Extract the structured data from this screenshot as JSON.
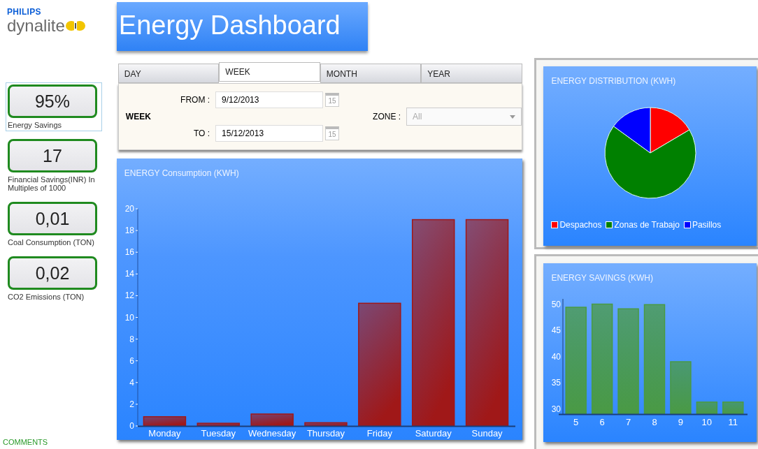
{
  "brand": {
    "company": "PHILIPS",
    "product": "dynalite"
  },
  "title": "Energy Dashboard",
  "kpis": [
    {
      "value": "95%",
      "label": "Energy Savings",
      "selected": true
    },
    {
      "value": "17",
      "label": "Financial Savings(INR) In Multiples of 1000",
      "selected": false
    },
    {
      "value": "0,01",
      "label": "Coal Consumption (TON)",
      "selected": false
    },
    {
      "value": "0,02",
      "label": "CO2 Emissions (TON)",
      "selected": false
    }
  ],
  "comments_link": "COMMENTS",
  "tabs": [
    {
      "label": "DAY",
      "selected": false
    },
    {
      "label": "WEEK",
      "selected": true
    },
    {
      "label": "MONTH",
      "selected": false
    },
    {
      "label": "YEAR",
      "selected": false
    }
  ],
  "filter": {
    "period": "WEEK",
    "from_label": "FROM :",
    "from_value": "9/12/2013",
    "to_label": "TO :",
    "to_value": "15/12/2013",
    "from_calendar_day": "15",
    "to_calendar_day": "15",
    "zone_label": "ZONE :",
    "zone_value": "All",
    "zone_disabled": true
  },
  "consumption": {
    "chart_data": {
      "type": "bar",
      "title": "ENERGY Consumption (KWH)",
      "categories": [
        "Monday",
        "Tuesday",
        "Wednesday",
        "Thursday",
        "Friday",
        "Saturday",
        "Sunday"
      ],
      "ylim": [
        0,
        20
      ],
      "yticks": [
        0,
        2,
        4,
        6,
        8,
        10,
        12,
        14,
        16,
        18,
        20
      ],
      "series": [
        {
          "color": "#a01818",
          "values": [
            0.85,
            0.25,
            1.1,
            0.3,
            11.3,
            19,
            19
          ]
        }
      ]
    }
  },
  "distribution": {
    "title": "ENERGY DISTRIBUTION (KWH)",
    "legend": [
      {
        "label": "Despachos",
        "color": "#ff0000"
      },
      {
        "label": "Zonas de Trabajo",
        "color": "#008000"
      },
      {
        "label": "Pasillos",
        "color": "#0000ff"
      }
    ]
  },
  "savings": {
    "chart_data": {
      "type": "bar",
      "title": "ENERGY SAVINGS (KWH)",
      "categories": [
        "5",
        "6",
        "7",
        "8",
        "9",
        "10",
        "11"
      ],
      "ylim": [
        29,
        51
      ],
      "yticks": [
        30,
        35,
        40,
        45,
        50
      ],
      "series": [
        {
          "color": "#4a9a44",
          "values": [
            49.4,
            50,
            49.1,
            49.9,
            39,
            31.3,
            31.3
          ]
        }
      ]
    }
  }
}
